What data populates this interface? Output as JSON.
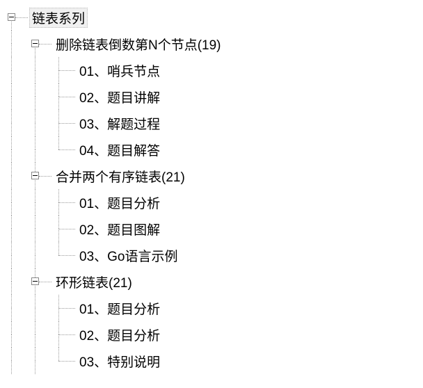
{
  "tree": {
    "label": "链表系列",
    "children": [
      {
        "label": "删除链表倒数第N个节点(19)",
        "children": [
          {
            "label": "01、哨兵节点"
          },
          {
            "label": "02、题目讲解"
          },
          {
            "label": "03、解题过程"
          },
          {
            "label": "04、题目解答"
          }
        ]
      },
      {
        "label": "合并两个有序链表(21)",
        "children": [
          {
            "label": "01、题目分析"
          },
          {
            "label": "02、题目图解"
          },
          {
            "label": "03、Go语言示例"
          }
        ]
      },
      {
        "label": "环形链表(21)",
        "children": [
          {
            "label": "01、题目分析"
          },
          {
            "label": "02、题目分析"
          },
          {
            "label": "03、特别说明"
          }
        ]
      }
    ]
  }
}
